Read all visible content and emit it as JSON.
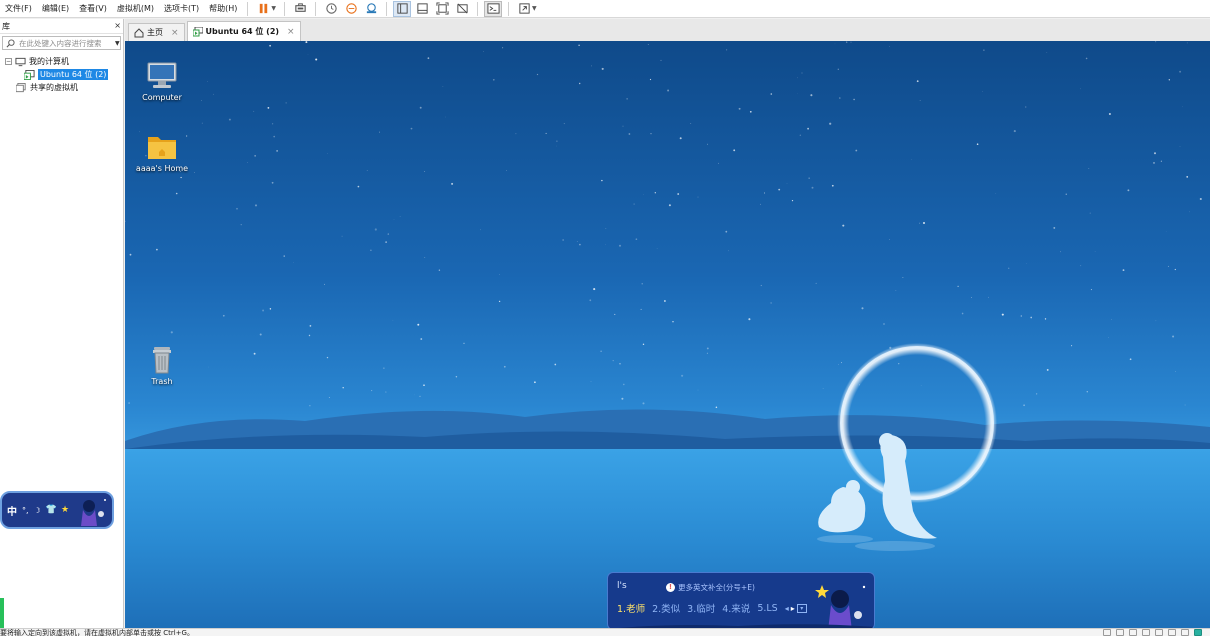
{
  "menu": {
    "items": [
      "文件(F)",
      "编辑(E)",
      "查看(V)",
      "虚拟机(M)",
      "选项卡(T)",
      "帮助(H)"
    ]
  },
  "toolbar": {
    "icons": [
      "pause-icon",
      "send-keys-icon",
      "snapshot-icon",
      "revert-snapshot-icon",
      "manage-snapshots-icon",
      "library-view-icon",
      "thumbnail-bar-icon",
      "fullscreen-icon",
      "unity-icon",
      "console-icon",
      "stretch-icon"
    ],
    "accent": "#e8701a"
  },
  "library": {
    "title": "库",
    "close_glyph": "×",
    "search_placeholder": "在此处键入内容进行搜索",
    "tree": {
      "my_computer": "我的计算机",
      "vm_name": "Ubuntu 64 位 (2)",
      "shared": "共享的虚拟机"
    }
  },
  "ime_toolbar": {
    "mode": "中",
    "punct": "°,",
    "moon": "☽",
    "shirt": "👕",
    "star": "★"
  },
  "tabs": [
    {
      "label": "主页",
      "active": false
    },
    {
      "label": "Ubuntu 64 位 (2)",
      "active": true
    }
  ],
  "desktop": {
    "icons": [
      {
        "label": "Computer",
        "icon": "computer-icon"
      },
      {
        "label": "aaaa's Home",
        "icon": "home-folder-icon"
      },
      {
        "label": "Trash",
        "icon": "trash-icon"
      }
    ],
    "colors": {
      "sky_top": "#0f4a8a",
      "sea": "#3a9ce0"
    }
  },
  "ime_candidates": {
    "input": "l's",
    "hint_badge": "!",
    "hint": "更多英文补全(分号+E)",
    "candidates": [
      "1.老师",
      "2.类似",
      "3.临时",
      "4.来说",
      "5.LS"
    ],
    "more_glyph": "▾"
  },
  "statusbar": {
    "text": "要将输入定向到该虚拟机，请在虚拟机内部单击或按 Ctrl+G。"
  }
}
